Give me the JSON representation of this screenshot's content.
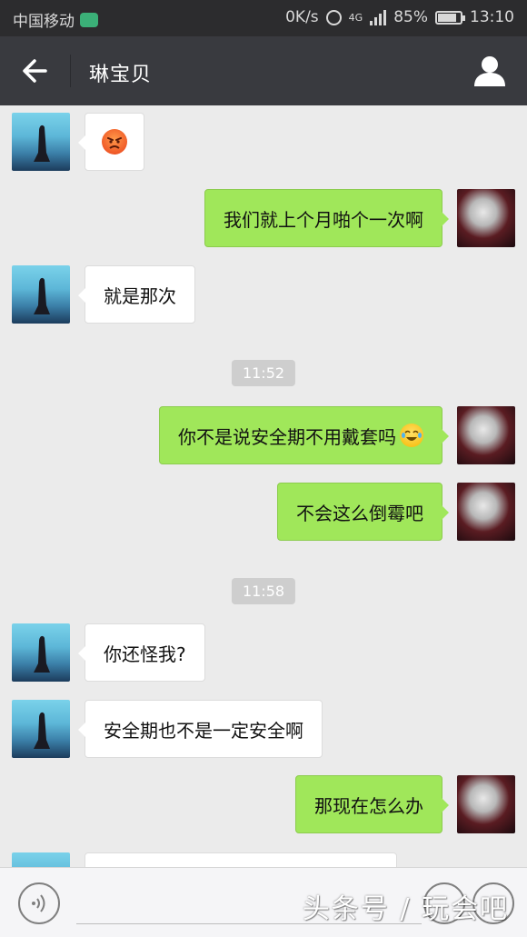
{
  "status_bar": {
    "carrier": "中国移动",
    "network_speed": "0K/s",
    "network_type": "4G",
    "battery_percent": "85%",
    "battery_level": 0.85,
    "time": "13:10"
  },
  "title_bar": {
    "title": "琳宝贝",
    "back_icon": "arrow-left-icon",
    "profile_icon": "person-icon"
  },
  "messages": [
    {
      "side": "in",
      "text": "",
      "emoji": "angry-face"
    },
    {
      "side": "out",
      "text": "我们就上个月啪个一次啊"
    },
    {
      "side": "in",
      "text": "就是那次"
    },
    {
      "timestamp": "11:52"
    },
    {
      "side": "out",
      "text": "你不是说安全期不用戴套吗",
      "emoji": "laughing-crying-face"
    },
    {
      "side": "out",
      "text": "不会这么倒霉吧"
    },
    {
      "timestamp": "11:58"
    },
    {
      "side": "in",
      "text": "你还怪我?"
    },
    {
      "side": "in",
      "text": "安全期也不是一定安全啊"
    },
    {
      "side": "out",
      "text": "那现在怎么办"
    }
  ],
  "input_bar": {
    "voice_icon": "voice-icon",
    "watermark": "头条号 / 玩会吧"
  },
  "colors": {
    "status_bar_bg": "#2c2c2e",
    "title_bar_bg": "#393a3f",
    "chat_bg": "#ebebeb",
    "outgoing_bubble": "#a0e75a",
    "incoming_bubble": "#ffffff",
    "timestamp_bg": "#cecece"
  }
}
